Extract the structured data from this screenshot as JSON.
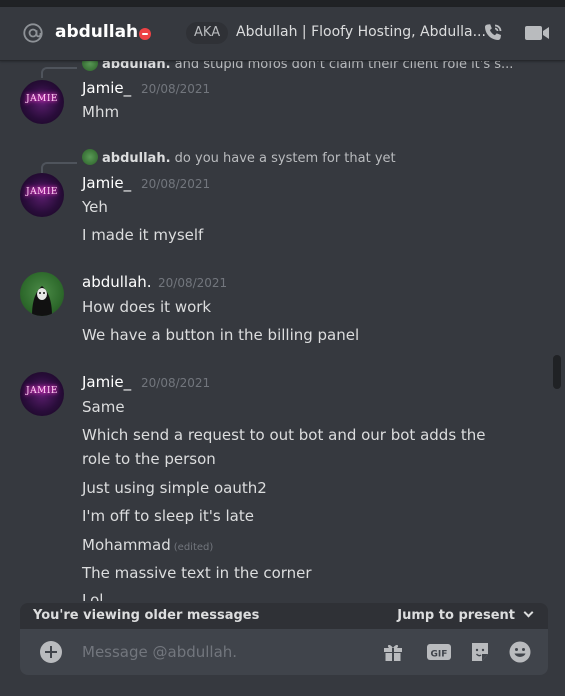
{
  "header": {
    "username": "abdullah.",
    "aka_label": "AKA",
    "aka_names": "Abdullah | Floofy Hosting, Abdulla..."
  },
  "messages": [
    {
      "reply_author": "abdullah.",
      "reply_text": "and stupid mofos don't claim their client role it's s...",
      "author": "Jamie_",
      "time": "20/08/2021",
      "lines": [
        "Mhm"
      ]
    },
    {
      "reply_author": "abdullah.",
      "reply_text": "do you have a system for that yet",
      "author": "Jamie_",
      "time": "20/08/2021",
      "lines": [
        "Yeh",
        "I made it myself"
      ]
    },
    {
      "author": "abdullah.",
      "time": "20/08/2021",
      "lines": [
        "How does it work",
        "We have a button in the billing panel"
      ]
    },
    {
      "author": "Jamie_",
      "time": "20/08/2021",
      "lines": [
        "Same",
        "Which send a request to out bot and our bot adds the",
        "role to the person",
        "Just using simple oauth2",
        "I'm off to sleep it's late",
        "Mohammad",
        "The massive text in the corner",
        "Lol"
      ],
      "edited_label": "(edited)"
    }
  ],
  "avatars": {
    "jamie_text": "JAMIE"
  },
  "older_bar": {
    "text": "You're viewing older messages",
    "jump_label": "Jump to present"
  },
  "composer": {
    "placeholder": "Message @abdullah.",
    "icons": [
      "gift-icon",
      "gif-icon",
      "sticker-icon",
      "emoji-icon"
    ],
    "gif_label": "GIF"
  },
  "colors": {
    "background": "#36393f",
    "dnd_status": "#ed4245",
    "muted": "#72767d"
  }
}
